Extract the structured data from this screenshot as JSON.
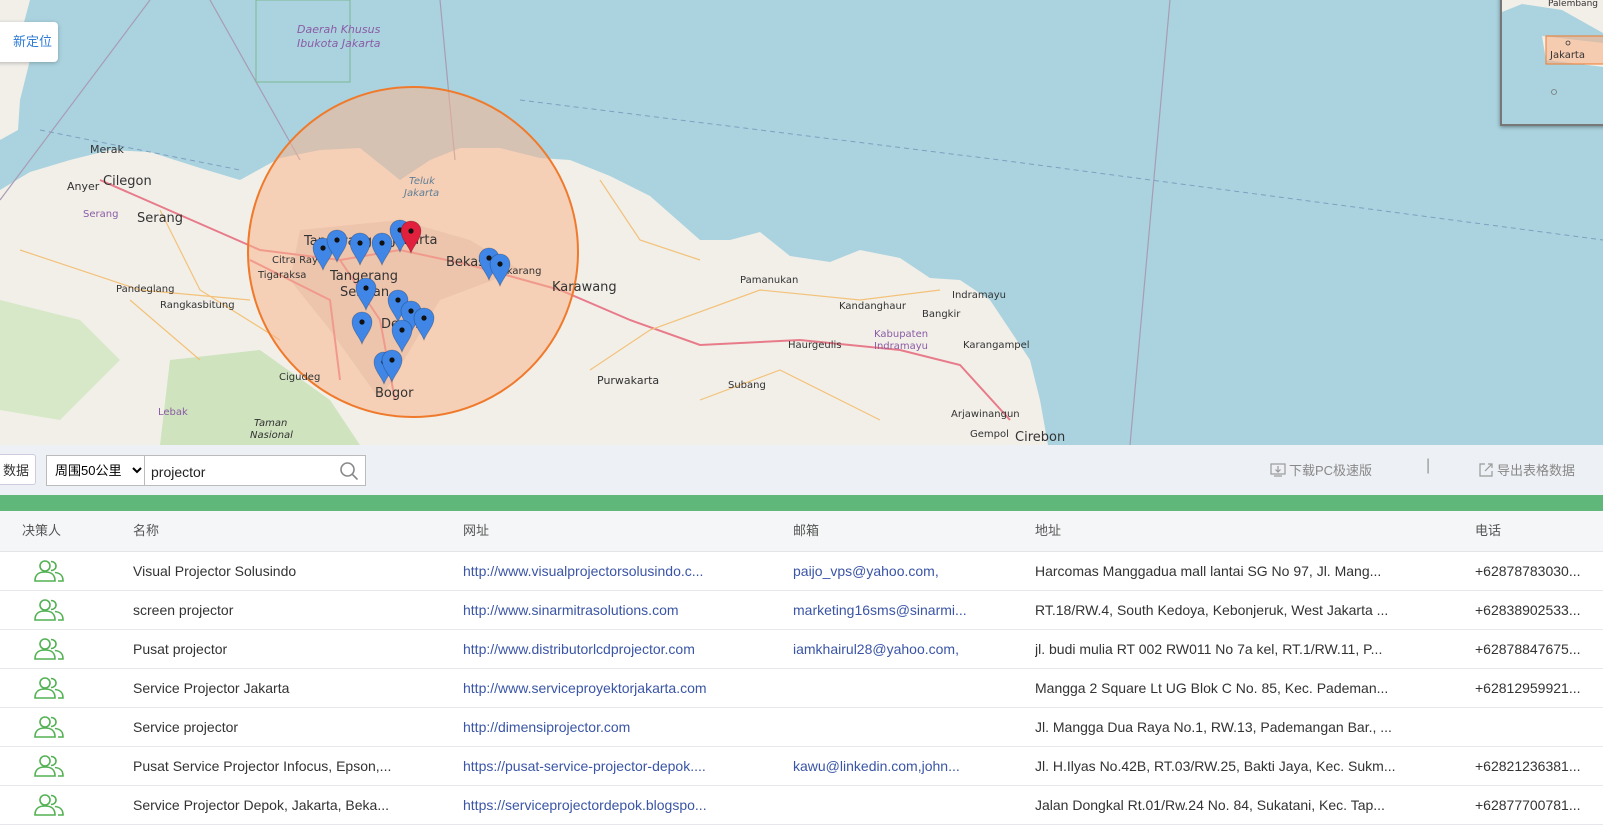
{
  "map": {
    "relocate_label": "新定位",
    "labels": {
      "dki": "Daerah Khusus",
      "dki2": "Ibukota Jakarta",
      "merak": "Merak",
      "anyer": "Anyer",
      "cilegon": "Cilegon",
      "serang": "Serang",
      "serang_region": "Serang",
      "tangerang": "Tangerang",
      "citra_raya": "Citra Raya",
      "tigaraksa": "Tigaraksa",
      "tangerang_selatan": "Tangerang",
      "selatan": "Selatan",
      "pandeglang": "Pandeglang",
      "rangkasbitung": "Rangkasbitung",
      "cigudeg": "Cigudeg",
      "lebak": "Lebak",
      "taman": "Taman",
      "nasional": "Nasional",
      "bogor": "Bogor",
      "depok": "Depok",
      "jakarta": "Jakarta",
      "teluk": "Teluk",
      "teluk_jakarta": "Jakarta",
      "bekasi": "Bekasi",
      "cikarang": "Cikarang",
      "karawang": "Karawang",
      "purwakarta": "Purwakarta",
      "subang": "Subang",
      "pamanukan": "Pamanukan",
      "kandanghaur": "Kandanghaur",
      "bangkir": "Bangkir",
      "indramayu": "Indramayu",
      "kab_indramayu": "Kabupaten",
      "kab_indramayu2": "Indramayu",
      "haurgeulis": "Haurgeulis",
      "karangampel": "Karangampel",
      "arjawinangun": "Arjawinangun",
      "gempol": "Gempol",
      "cirebon": "Cirebon",
      "mini_palembang": "Palembang",
      "mini_jakarta": "Jakarta"
    }
  },
  "toolbar": {
    "data_label": "数据",
    "radius_selected": "周围50公里",
    "search_value": "projector",
    "download_label": "下载PC极速版",
    "divider": "|",
    "export_label": "导出表格数据"
  },
  "table": {
    "headers": {
      "decision": "决策人",
      "name": "名称",
      "website": "网址",
      "email": "邮箱",
      "address": "地址",
      "phone": "电话"
    },
    "rows": [
      {
        "name": "Visual Projector Solusindo",
        "website": "http://www.visualprojectorsolusindo.c...",
        "email": "paijo_vps@yahoo.com,",
        "address": "Harcomas Manggadua mall lantai SG No 97, Jl. Mang...",
        "phone": "+62878783030..."
      },
      {
        "name": "screen projector",
        "website": "http://www.sinarmitrasolutions.com",
        "email": "marketing16sms@sinarmi...",
        "address": "RT.18/RW.4, South Kedoya, Kebonjeruk, West Jakarta ...",
        "phone": "+62838902533..."
      },
      {
        "name": "Pusat projector",
        "website": "http://www.distributorlcdprojector.com",
        "email": "iamkhairul28@yahoo.com,",
        "address": "jl. budi mulia RT 002 RW011 No 7a kel, RT.1/RW.11, P...",
        "phone": "+62878847675..."
      },
      {
        "name": "Service Projector Jakarta",
        "website": "http://www.serviceproyektorjakarta.com",
        "email": "",
        "address": "Mangga 2 Square Lt UG Blok C No. 85, Kec. Pademan...",
        "phone": "+62812959921..."
      },
      {
        "name": "Service projector",
        "website": "http://dimensiprojector.com",
        "email": "",
        "address": "Jl. Mangga Dua Raya No.1, RW.13, Pademangan Bar., ...",
        "phone": ""
      },
      {
        "name": "Pusat Service Projector Infocus, Epson,...",
        "website": "https://pusat-service-projector-depok....",
        "email": "kawu@linkedin.com,john...",
        "address": "Jl. H.Ilyas No.42B, RT.03/RW.25, Bakti Jaya, Kec. Sukm...",
        "phone": "+62821236381..."
      },
      {
        "name": "Service Projector Depok, Jakarta, Beka...",
        "website": "https://serviceprojectordepok.blogspo...",
        "email": "",
        "address": "Jalan Dongkal Rt.01/Rw.24 No. 84, Sukatani, Kec. Tap...",
        "phone": "+62877700781..."
      }
    ]
  },
  "colors": {
    "sea": "#aad3df",
    "land": "#f2efe9",
    "circle_stroke": "#f07a2c",
    "circle_fill": "#f8b48c",
    "marker_blue": "#3f86e6",
    "marker_red": "#e0203c",
    "green_bar": "#5fb87a",
    "link": "#3a55a6",
    "people_icon": "#52b152"
  }
}
